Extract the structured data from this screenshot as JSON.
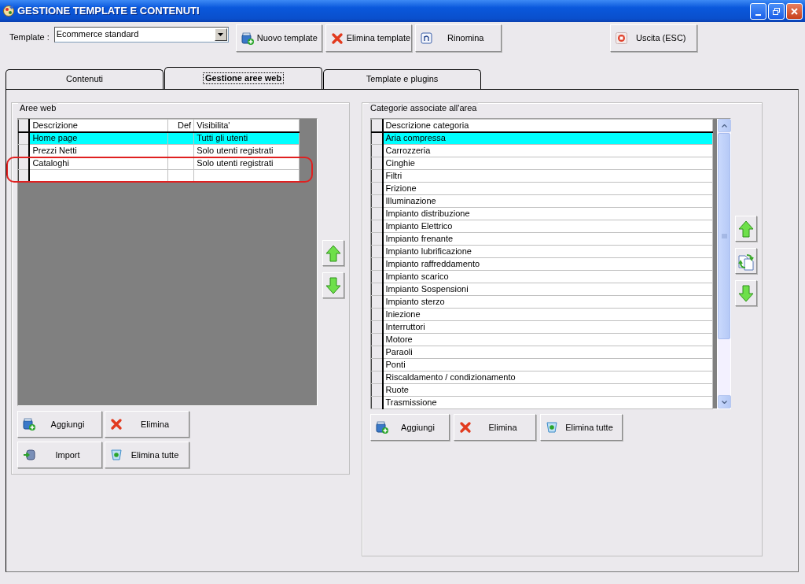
{
  "window": {
    "title": "GESTIONE TEMPLATE E CONTENUTI"
  },
  "toolbar": {
    "template_label": "Template :",
    "template_value": "Ecommerce standard",
    "buttons": [
      "Nuovo template",
      "Elimina template",
      "Rinomina"
    ],
    "exit_button": "Uscita (ESC)"
  },
  "tabs": [
    {
      "label": "Contenuti",
      "selected": false
    },
    {
      "label": "Gestione aree web",
      "selected": true
    },
    {
      "label": "Template e plugins",
      "selected": false
    }
  ],
  "aree_web": {
    "title": "Aree web",
    "columns": [
      "Descrizione",
      "Def",
      "Visibilita'"
    ],
    "rows": [
      {
        "descrizione": "Home page",
        "visibilita": "Tutti gli utenti",
        "selected": true
      },
      {
        "descrizione": "Prezzi Netti",
        "visibilita": "Solo utenti registrati",
        "selected": false
      },
      {
        "descrizione": "Cataloghi",
        "visibilita": "Solo utenti registrati",
        "selected": false
      }
    ],
    "buttons": [
      "Aggiungi",
      "Elimina",
      "Import",
      "Elimina tutte"
    ]
  },
  "categorie": {
    "title": "Categorie associate all'area",
    "column": "Descrizione categoria",
    "rows": [
      {
        "name": "Aria compressa",
        "selected": true
      },
      {
        "name": "Carrozzeria",
        "selected": false
      },
      {
        "name": "Cinghie",
        "selected": false
      },
      {
        "name": "Filtri",
        "selected": false
      },
      {
        "name": "Frizione",
        "selected": false
      },
      {
        "name": "Illuminazione",
        "selected": false
      },
      {
        "name": "Impianto distribuzione",
        "selected": false
      },
      {
        "name": "Impianto Elettrico",
        "selected": false
      },
      {
        "name": "Impianto frenante",
        "selected": false
      },
      {
        "name": "Impianto lubrificazione",
        "selected": false
      },
      {
        "name": "Impianto raffreddamento",
        "selected": false
      },
      {
        "name": "Impianto scarico",
        "selected": false
      },
      {
        "name": "Impianto Sospensioni",
        "selected": false
      },
      {
        "name": "Impianto sterzo",
        "selected": false
      },
      {
        "name": "Iniezione",
        "selected": false
      },
      {
        "name": "Interruttori",
        "selected": false
      },
      {
        "name": "Motore",
        "selected": false
      },
      {
        "name": "Paraoli",
        "selected": false
      },
      {
        "name": "Ponti",
        "selected": false
      },
      {
        "name": "Riscaldamento / condizionamento",
        "selected": false
      },
      {
        "name": "Ruote",
        "selected": false
      },
      {
        "name": "Trasmissione",
        "selected": false
      }
    ],
    "buttons": [
      "Aggiungi",
      "Elimina",
      "Elimina tutte"
    ]
  }
}
